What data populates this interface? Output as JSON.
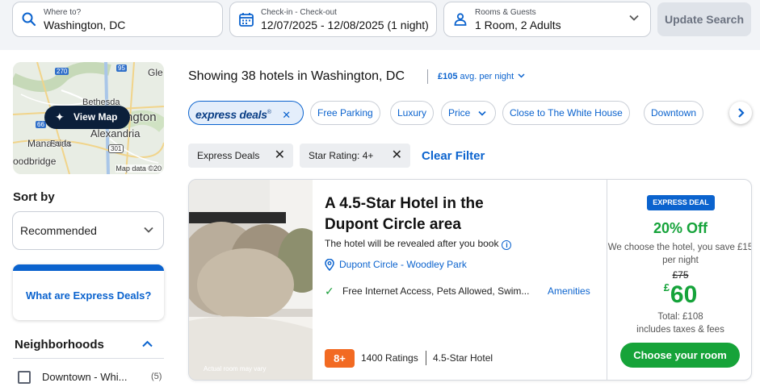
{
  "search": {
    "where_label": "Where to?",
    "where_value": "Washington, DC",
    "dates_label": "Check-in - Check-out",
    "dates_value": "12/07/2025 - 12/08/2025 (1 night)",
    "rooms_label": "Rooms & Guests",
    "rooms_value": "1 Room, 2 Adults",
    "update_label": "Update Search"
  },
  "map": {
    "button_label": "View Map",
    "labels": [
      "270",
      "95",
      "Gle",
      "Bethesda",
      "ngton",
      "Alexandria",
      "Manassas",
      "oodbridge",
      "66",
      "301",
      "Fairfa"
    ],
    "credit": "Map data ©20"
  },
  "sort": {
    "label": "Sort by",
    "value": "Recommended"
  },
  "express_card": {
    "text": "What are Express Deals?"
  },
  "neighborhoods": {
    "title": "Neighborhoods",
    "items": [
      {
        "label": "Downtown - Whi...",
        "count": "(5)"
      }
    ]
  },
  "results": {
    "showing": "Showing 38 hotels in Washington, DC",
    "avg_amount": "£105",
    "avg_suffix": " avg. per night"
  },
  "chips": {
    "express": "express deals",
    "free_parking": "Free Parking",
    "luxury": "Luxury",
    "price": "Price",
    "white_house": "Close to The White House",
    "downtown": "Downtown"
  },
  "filters": {
    "tags": [
      "Express Deals",
      "Star Rating: 4+"
    ],
    "clear": "Clear Filter"
  },
  "hotel": {
    "title": "A 4.5-Star Hotel in the Dupont Circle area",
    "reveal": "The hotel will be revealed after you book",
    "location": "Dupont Circle - Woodley Park",
    "amenities": "Free Internet Access, Pets Allowed, Swim...",
    "amenities_link": "Amenities",
    "photo_caption": "Actual room may vary",
    "rating_score": "8+",
    "rating_count": "1400 Ratings",
    "star_label": "4.5-Star Hotel",
    "deal_badge": "EXPRESS DEAL",
    "percent_off": "20% Off",
    "choose_text": "We choose the hotel, you save £15 per night",
    "old_price": "£75",
    "currency": "£",
    "new_price": "60",
    "total": "Total: £108",
    "includes": "includes taxes & fees",
    "cta": "Choose your room"
  },
  "colors": {
    "brand_blue": "#0b63ce",
    "deal_green": "#15a33a",
    "rating_orange": "#f26a22",
    "map_button": "#0b1f3a"
  }
}
